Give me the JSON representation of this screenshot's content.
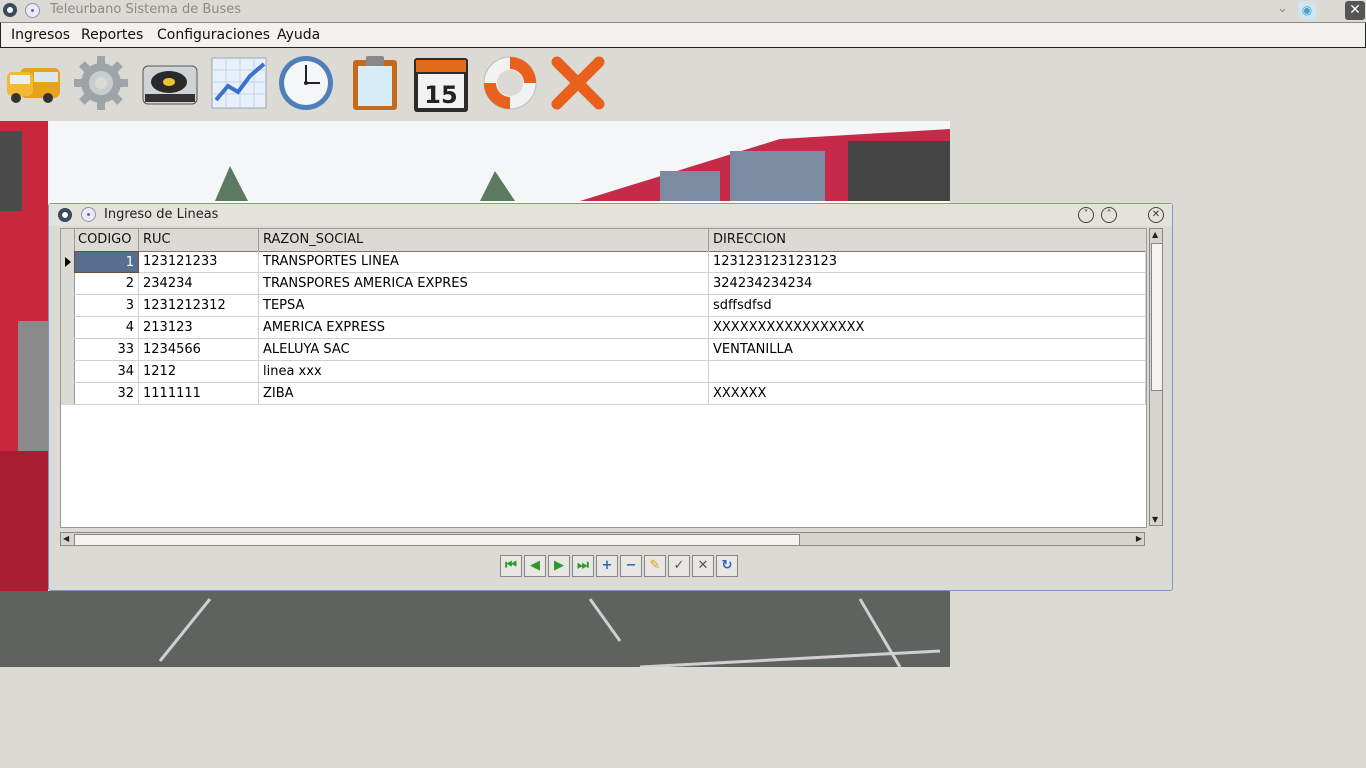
{
  "window": {
    "title": "Teleurbano Sistema de Buses"
  },
  "menu": {
    "items": [
      "Ingresos",
      "Reportes",
      "Configuraciones",
      "Ayuda"
    ]
  },
  "toolbar": {
    "icons": [
      "bus-icon",
      "gear-icon",
      "turntable-icon",
      "chart-icon",
      "clock-icon",
      "clipboard-icon",
      "calendar-icon",
      "lifebuoy-icon",
      "exit-icon"
    ],
    "calendar_day": "15"
  },
  "frame": {
    "title": "Ingreso de Lineas",
    "table": {
      "columns": [
        "CODIGO",
        "RUC",
        "RAZON_SOCIAL",
        "DIRECCION"
      ],
      "rows": [
        [
          "1",
          "123121233",
          "TRANSPORTES LINEA",
          "123123123123123"
        ],
        [
          "2",
          "234234",
          "TRANSPORES AMERICA EXPRES",
          "324234234234"
        ],
        [
          "3",
          "1231212312",
          "TEPSA",
          "sdffsdfsd"
        ],
        [
          "4",
          "213123",
          "AMERICA EXPRESS",
          "XXXXXXXXXXXXXXXXX"
        ],
        [
          "33",
          "1234566",
          "ALELUYA SAC",
          "VENTANILLA"
        ],
        [
          "34",
          "1212",
          "linea xxx",
          ""
        ],
        [
          "32",
          "1111111",
          "ZIBA",
          "XXXXXX"
        ]
      ]
    },
    "navigator": [
      "first",
      "prior",
      "next",
      "last",
      "insert",
      "delete",
      "edit",
      "post",
      "cancel",
      "refresh"
    ]
  },
  "colors": {
    "background": "#dcdad5",
    "selected_cell": "#576f8c",
    "frame_border": "#7a9ac2",
    "exit_orange": "#e8601c"
  }
}
